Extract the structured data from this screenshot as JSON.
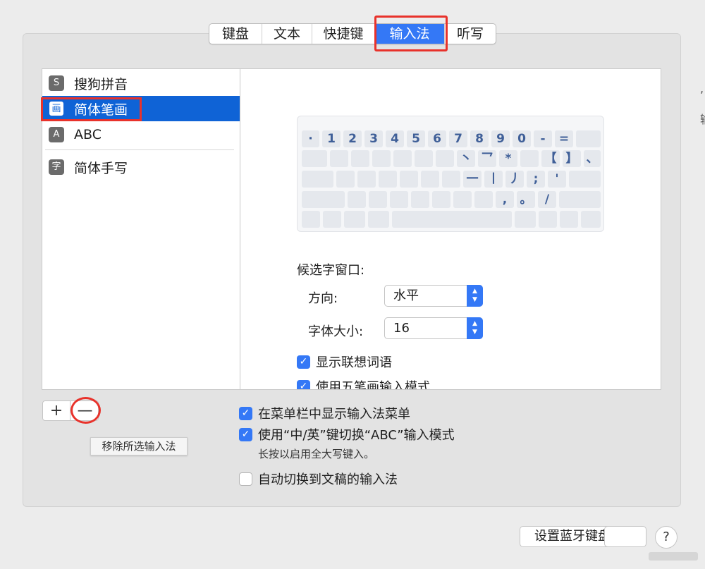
{
  "tabs": [
    {
      "label": "键盘",
      "active": false
    },
    {
      "label": "文本",
      "active": false
    },
    {
      "label": "快捷键",
      "active": false
    },
    {
      "label": "输入法",
      "active": true
    },
    {
      "label": "听写",
      "active": false
    }
  ],
  "input_sources": [
    {
      "label": "搜狗拼音",
      "icon": "S",
      "selected": false
    },
    {
      "label": "简体笔画",
      "icon": "画",
      "selected": true
    },
    {
      "label": "ABC",
      "icon": "A",
      "selected": false
    },
    {
      "label": "简体手写",
      "icon": "字",
      "selected": false
    }
  ],
  "keyboard": {
    "row1": [
      "·",
      "1",
      "2",
      "3",
      "4",
      "5",
      "6",
      "7",
      "8",
      "9",
      "0",
      "-",
      "="
    ],
    "row2": [
      "丶",
      "乛",
      "*",
      "【",
      "】",
      "、"
    ],
    "row3": [
      "一",
      "丨",
      "丿",
      ";",
      "'"
    ],
    "row4": [
      ",",
      "。",
      "/"
    ]
  },
  "candidate_window": {
    "title": "候选字窗口:",
    "direction_label": "方向:",
    "direction_value": "水平",
    "font_size_label": "字体大小:",
    "font_size_value": "16"
  },
  "detail_checks": [
    {
      "label": "显示联想词语",
      "checked": true
    },
    {
      "label": "使用五笔画输入模式",
      "checked": true
    }
  ],
  "add_remove": {
    "plus": "+",
    "minus": "—"
  },
  "tooltip": "移除所选输入法",
  "options": [
    {
      "label": "在菜单栏中显示输入法菜单",
      "checked": true
    },
    {
      "label": "使用“中/英”键切换“ABC”输入模式",
      "checked": true
    },
    {
      "label": "自动切换到文稿的输入法",
      "checked": false
    }
  ],
  "options_note": "长按以启用全大写键入。",
  "bottom": {
    "setup_keyboard_label": "设置蓝牙键盘",
    "second_button_label": "",
    "help_label": "?"
  },
  "edge_text": [
    ",",
    "输"
  ],
  "colors": {
    "accent": "#3478f6",
    "selection": "#0f63d6",
    "highlight_box": "#e8322b",
    "key_text": "#3f5f98"
  }
}
